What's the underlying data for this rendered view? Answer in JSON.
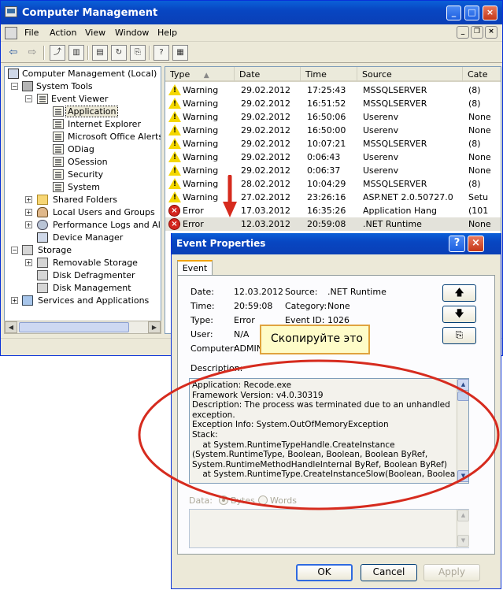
{
  "main_window": {
    "title": "Computer Management",
    "menu": [
      "File",
      "Action",
      "View",
      "Window",
      "Help"
    ],
    "tree": [
      {
        "label": "Computer Management (Local)",
        "icon": "computer-icon"
      },
      {
        "label": "System Tools",
        "icon": "tools-icon"
      },
      {
        "label": "Event Viewer",
        "icon": "event-viewer-icon"
      },
      {
        "label": "Application",
        "icon": "log-icon"
      },
      {
        "label": "Internet Explorer",
        "icon": "log-icon"
      },
      {
        "label": "Microsoft Office Alerts",
        "icon": "log-icon"
      },
      {
        "label": "ODiag",
        "icon": "log-icon"
      },
      {
        "label": "OSession",
        "icon": "log-icon"
      },
      {
        "label": "Security",
        "icon": "log-icon"
      },
      {
        "label": "System",
        "icon": "log-icon"
      },
      {
        "label": "Shared Folders",
        "icon": "folder-icon"
      },
      {
        "label": "Local Users and Groups",
        "icon": "users-icon"
      },
      {
        "label": "Performance Logs and Alerts",
        "icon": "performance-icon"
      },
      {
        "label": "Device Manager",
        "icon": "device-manager-icon"
      },
      {
        "label": "Storage",
        "icon": "storage-icon"
      },
      {
        "label": "Removable Storage",
        "icon": "removable-storage-icon"
      },
      {
        "label": "Disk Defragmenter",
        "icon": "defrag-icon"
      },
      {
        "label": "Disk Management",
        "icon": "disk-management-icon"
      },
      {
        "label": "Services and Applications",
        "icon": "services-icon"
      }
    ],
    "columns": [
      "Type",
      "Date",
      "Time",
      "Source",
      "Cate"
    ],
    "events": [
      {
        "type": "Warning",
        "date": "29.02.2012",
        "time": "17:25:43",
        "source": "MSSQLSERVER",
        "category": "(8)"
      },
      {
        "type": "Warning",
        "date": "29.02.2012",
        "time": "16:51:52",
        "source": "MSSQLSERVER",
        "category": "(8)"
      },
      {
        "type": "Warning",
        "date": "29.02.2012",
        "time": "16:50:06",
        "source": "Userenv",
        "category": "None"
      },
      {
        "type": "Warning",
        "date": "29.02.2012",
        "time": "16:50:00",
        "source": "Userenv",
        "category": "None"
      },
      {
        "type": "Warning",
        "date": "29.02.2012",
        "time": "10:07:21",
        "source": "MSSQLSERVER",
        "category": "(8)"
      },
      {
        "type": "Warning",
        "date": "29.02.2012",
        "time": "0:06:43",
        "source": "Userenv",
        "category": "None"
      },
      {
        "type": "Warning",
        "date": "29.02.2012",
        "time": "0:06:37",
        "source": "Userenv",
        "category": "None"
      },
      {
        "type": "Warning",
        "date": "28.02.2012",
        "time": "10:04:29",
        "source": "MSSQLSERVER",
        "category": "(8)"
      },
      {
        "type": "Warning",
        "date": "27.02.2012",
        "time": "23:26:16",
        "source": "ASP.NET 2.0.50727.0",
        "category": "Setu"
      },
      {
        "type": "Error",
        "date": "17.03.2012",
        "time": "16:35:26",
        "source": "Application Hang",
        "category": "(101"
      },
      {
        "type": "Error",
        "date": "12.03.2012",
        "time": "20:59:08",
        "source": ".NET Runtime",
        "category": "None"
      }
    ]
  },
  "dialog": {
    "title": "Event Properties",
    "tab": "Event",
    "fields": {
      "date_label": "Date:",
      "date_value": "12.03.2012",
      "source_label": "Source:",
      "source_value": ".NET Runtime",
      "time_label": "Time:",
      "time_value": "20:59:08",
      "category_label": "Category:",
      "category_value": "None",
      "type_label": "Type:",
      "type_value": "Error",
      "event_id_label": "Event ID:",
      "event_id_value": "1026",
      "user_label": "User:",
      "user_value": "N/A",
      "computer_label": "Computer:",
      "computer_value": "ADMIN"
    },
    "description_label": "Description:",
    "description": "Application: Recode.exe\nFramework Version: v4.0.30319\nDescription: The process was terminated due to an unhandled\nexception.\nException Info: System.OutOfMemoryException\nStack:\n    at System.RuntimeTypeHandle.CreateInstance\n(System.RuntimeType, Boolean, Boolean, Boolean ByRef,\nSystem.RuntimeMethodHandleInternal ByRef, Boolean ByRef)\n    at System.RuntimeType.CreateInstanceSlow(Boolean, Boolean,",
    "data_label": "Data:",
    "data_options": [
      "Bytes",
      "Words"
    ],
    "buttons": {
      "ok": "OK",
      "cancel": "Cancel",
      "apply": "Apply"
    },
    "callout": "Скопируйте это"
  },
  "colors": {
    "titlebar": "#0a3fb6",
    "error": "#d4251e",
    "warning": "#f5d800",
    "annotation_red": "#d62b1e",
    "callout_bg": "#fefcc8"
  }
}
